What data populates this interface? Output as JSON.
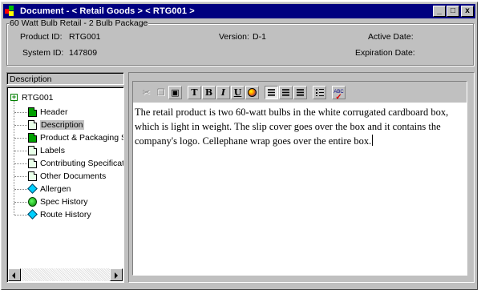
{
  "window": {
    "title": "Document - < Retail Goods > < RTG001 >",
    "controls": {
      "minimize": "_",
      "maximize": "□",
      "close": "x"
    }
  },
  "header": {
    "group_label": "60 Watt Bulb Retail - 2 Bulb Package",
    "product_id_label": "Product ID:",
    "product_id": "RTG001",
    "system_id_label": "System ID:",
    "system_id": "147809",
    "version_label": "Version:",
    "version": "D-1",
    "active_date_label": "Active Date:",
    "active_date": "",
    "expiration_date_label": "Expiration Date:",
    "expiration_date": ""
  },
  "tree": {
    "title": "Description",
    "root": "RTG001",
    "items": [
      {
        "label": "Header",
        "icon": "document-icon-filled"
      },
      {
        "label": "Description",
        "icon": "document-icon",
        "selected": true
      },
      {
        "label": "Product & Packaging S",
        "icon": "document-icon-filled"
      },
      {
        "label": "Labels",
        "icon": "document-icon"
      },
      {
        "label": "Contributing Specificatio",
        "icon": "document-icon"
      },
      {
        "label": "Other Documents",
        "icon": "document-icon"
      },
      {
        "label": "Allergen",
        "icon": "diamond-icon"
      },
      {
        "label": "Spec History",
        "icon": "globe-icon"
      },
      {
        "label": "Route History",
        "icon": "diamond-icon"
      }
    ]
  },
  "toolbar": {
    "cut": "cut-icon",
    "copy": "copy-icon",
    "paste": "paste-icon",
    "font_label": "T",
    "bold_label": "B",
    "italic_label": "I",
    "underline_label": "U",
    "color": "color-icon",
    "align_left": "align-left-icon",
    "align_center": "align-center-icon",
    "align_right": "align-right-icon",
    "bullets": "bullet-list-icon",
    "spell_label": "ABC"
  },
  "editor": {
    "text": "The retail product is two 60-watt bulbs in the white corrugated cardboard box, which is light in weight.  The slip cover goes over the box and it contains the company's logo.  Cellephane wrap goes over the entire box."
  }
}
